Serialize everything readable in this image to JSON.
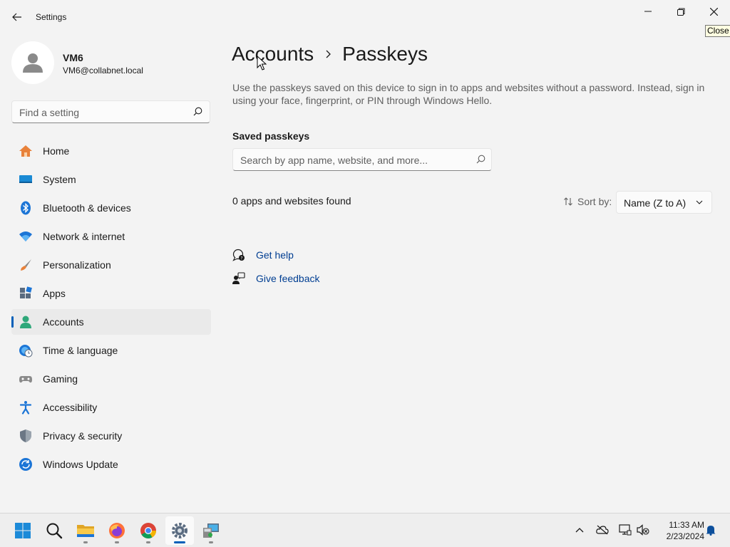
{
  "window": {
    "title": "Settings",
    "tooltip": "Close"
  },
  "profile": {
    "name": "VM6",
    "email": "VM6@collabnet.local"
  },
  "sidebar": {
    "search_placeholder": "Find a setting",
    "items": [
      {
        "label": "Home",
        "icon": "home-icon"
      },
      {
        "label": "System",
        "icon": "system-icon"
      },
      {
        "label": "Bluetooth & devices",
        "icon": "bluetooth-icon"
      },
      {
        "label": "Network & internet",
        "icon": "wifi-icon"
      },
      {
        "label": "Personalization",
        "icon": "brush-icon"
      },
      {
        "label": "Apps",
        "icon": "apps-icon"
      },
      {
        "label": "Accounts",
        "icon": "accounts-icon",
        "active": true
      },
      {
        "label": "Time & language",
        "icon": "globe-clock-icon"
      },
      {
        "label": "Gaming",
        "icon": "gamepad-icon"
      },
      {
        "label": "Accessibility",
        "icon": "accessibility-icon"
      },
      {
        "label": "Privacy & security",
        "icon": "shield-icon"
      },
      {
        "label": "Windows Update",
        "icon": "update-icon"
      }
    ]
  },
  "main": {
    "breadcrumb_parent": "Accounts",
    "breadcrumb_current": "Passkeys",
    "description": "Use the passkeys saved on this device to sign in to apps and websites without a password. Instead, sign in using your face, fingerprint, or PIN through Windows Hello.",
    "section_title": "Saved passkeys",
    "search_placeholder": "Search by app name, website, and more...",
    "count_text": "0 apps and websites found",
    "sort_label": "Sort by:",
    "sort_value": "Name (Z to A)",
    "links": [
      {
        "label": "Get help",
        "icon": "help-icon"
      },
      {
        "label": "Give feedback",
        "icon": "feedback-icon"
      }
    ]
  },
  "taskbar": {
    "apps": [
      "start-icon",
      "search-icon",
      "file-explorer-icon",
      "firefox-icon",
      "chrome-icon",
      "settings-icon",
      "remote-desktop-icon"
    ],
    "time": "11:33 AM",
    "date": "2/23/2024"
  },
  "colors": {
    "accent": "#005fb8",
    "link": "#003e92",
    "background": "#f3f3f3"
  }
}
